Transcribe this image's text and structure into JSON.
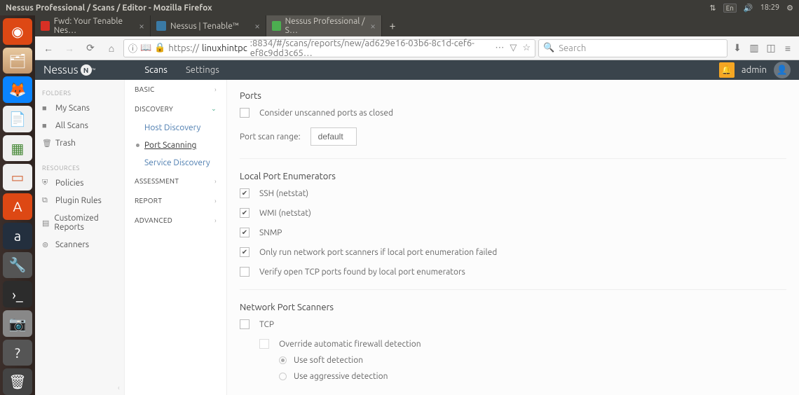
{
  "titlebar": {
    "title": "Nessus Professional / Scans / Editor - Mozilla Firefox",
    "time": "18:29",
    "lang": "En"
  },
  "tabs": [
    {
      "label": "Fwd: Your Tenable Nes…"
    },
    {
      "label": "Nessus | Tenable™"
    },
    {
      "label": "Nessus Professional / S…"
    }
  ],
  "url": {
    "scheme": "https://",
    "host": "linuxhintpc",
    "rest": ":8834/#/scans/reports/new/ad629e16-03b6-8c1d-cef6-ef8c9dd3c65…"
  },
  "search_placeholder": "Search",
  "app": {
    "brand": "Nessus",
    "nav": {
      "scans": "Scans",
      "settings": "Settings"
    },
    "user": "admin"
  },
  "left_sidebar": {
    "folders_h": "FOLDERS",
    "folders": [
      {
        "icon": "■",
        "label": "My Scans"
      },
      {
        "icon": "■",
        "label": "All Scans"
      },
      {
        "icon": "🗑",
        "label": "Trash"
      }
    ],
    "resources_h": "RESOURCES",
    "resources": [
      {
        "icon": "⛨",
        "label": "Policies"
      },
      {
        "icon": "⧉",
        "label": "Plugin Rules"
      },
      {
        "icon": "▤",
        "label": "Customized Reports"
      },
      {
        "icon": "⊚",
        "label": "Scanners"
      }
    ]
  },
  "mid": {
    "basic": "BASIC",
    "discovery": "DISCOVERY",
    "disc_items": {
      "host": "Host Discovery",
      "port": "Port Scanning",
      "service": "Service Discovery"
    },
    "assessment": "ASSESSMENT",
    "report": "REPORT",
    "advanced": "ADVANCED"
  },
  "main": {
    "ports_h": "Ports",
    "unscanned": "Consider unscanned ports as closed",
    "range_label": "Port scan range:",
    "range_value": "default",
    "lpe_h": "Local Port Enumerators",
    "lpe": {
      "ssh": "SSH (netstat)",
      "wmi": "WMI (netstat)",
      "snmp": "SNMP",
      "only": "Only run network port scanners if local port enumeration failed",
      "verify": "Verify open TCP ports found by local port enumerators"
    },
    "nps_h": "Network Port Scanners",
    "nps": {
      "tcp": "TCP",
      "override": "Override automatic firewall detection",
      "soft": "Use soft detection",
      "aggr": "Use aggressive detection"
    }
  }
}
